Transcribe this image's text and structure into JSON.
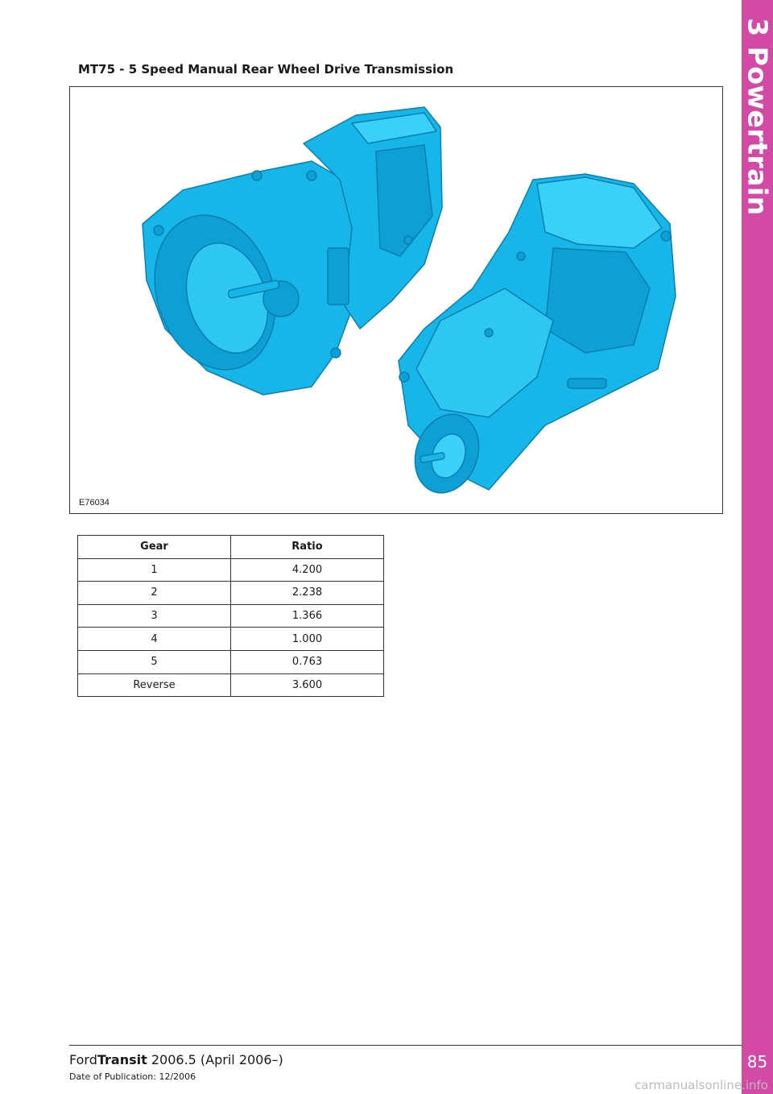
{
  "sidebar": {
    "section_label": "3 Powertrain",
    "page_number": "85",
    "accent_color": "#d24aa6"
  },
  "section_title": "MT75 - 5 Speed Manual Rear Wheel Drive Transmission",
  "figure": {
    "id": "E76034",
    "illustration_color": "#16b7e8"
  },
  "table": {
    "headers": [
      "Gear",
      "Ratio"
    ],
    "rows": [
      [
        "1",
        "4.200"
      ],
      [
        "2",
        "2.238"
      ],
      [
        "3",
        "1.366"
      ],
      [
        "4",
        "1.000"
      ],
      [
        "5",
        "0.763"
      ],
      [
        "Reverse",
        "3.600"
      ]
    ]
  },
  "footer": {
    "brand": "Ford",
    "model": "Transit",
    "edition": " 2006.5 (April 2006–)",
    "publication": "Date of Publication: 12/2006"
  },
  "watermark": "carmanualsonline.info"
}
